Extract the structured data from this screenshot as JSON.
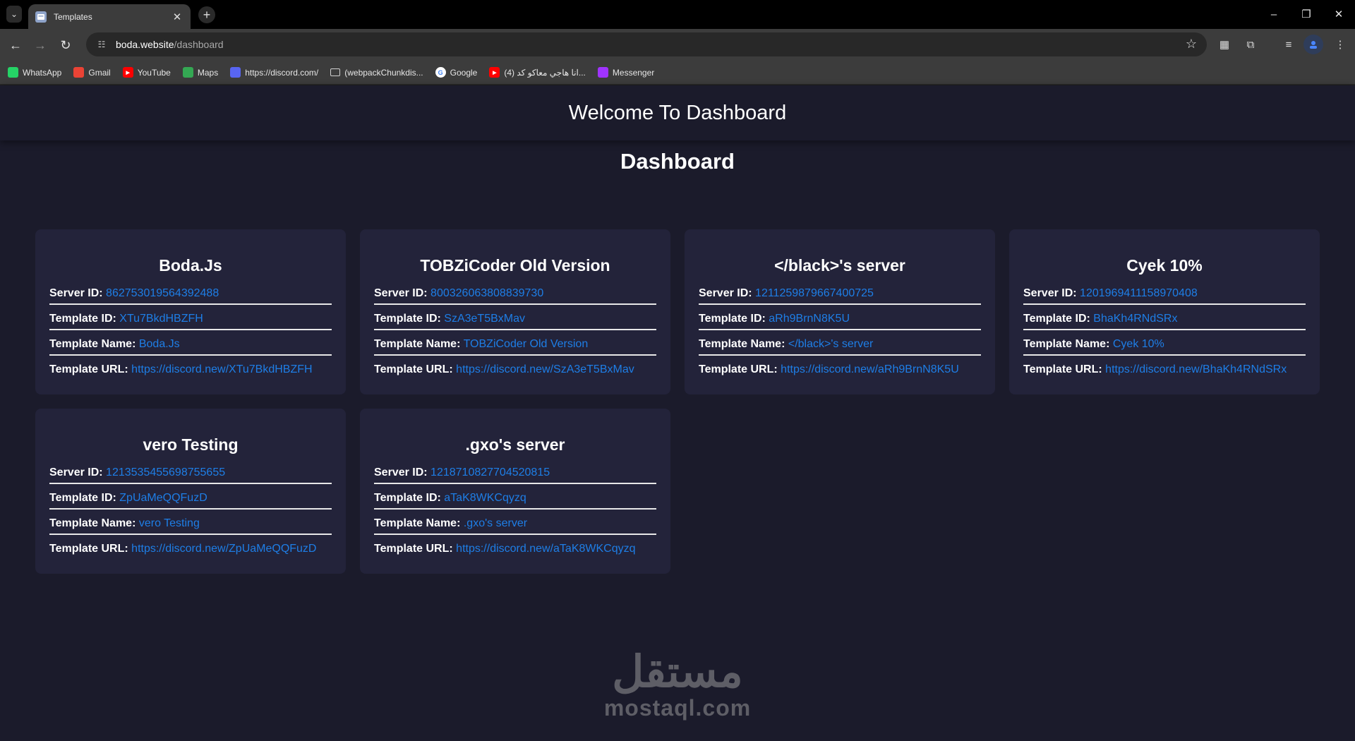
{
  "browser": {
    "tab_title": "Templates",
    "url_host": "boda.website",
    "url_path": "/dashboard",
    "bookmarks": [
      {
        "label": "WhatsApp",
        "icon": "whatsapp-icon",
        "color": "#25d366"
      },
      {
        "label": "Gmail",
        "icon": "gmail-icon",
        "color": "#ea4335"
      },
      {
        "label": "YouTube",
        "icon": "youtube-icon",
        "color": "#ff0000"
      },
      {
        "label": "Maps",
        "icon": "maps-icon",
        "color": "#34a853"
      },
      {
        "label": "https://discord.com/",
        "icon": "discord-icon",
        "color": "#5865f2"
      },
      {
        "label": "(webpackChunkdis...",
        "icon": "folder-icon",
        "color": "#3c3c3c"
      },
      {
        "label": "Google",
        "icon": "google-icon",
        "color": "#ffffff"
      },
      {
        "label": "(4) انا هاجي معاكو كد...",
        "icon": "youtube-icon",
        "color": "#ff0000"
      },
      {
        "label": "Messenger",
        "icon": "messenger-icon",
        "color": "#a033ff"
      }
    ]
  },
  "page": {
    "header_title": "Welcome To Dashboard",
    "dashboard_title": "Dashboard",
    "labels": {
      "server_id": "Server ID:",
      "template_id": "Template ID:",
      "template_name": "Template Name:",
      "template_url": "Template URL:"
    },
    "cards": [
      {
        "name": "Boda.Js",
        "server_id": "862753019564392488",
        "template_id": "XTu7BkdHBZFH",
        "template_name": "Boda.Js",
        "template_url": "https://discord.new/XTu7BkdHBZFH"
      },
      {
        "name": "TOBZiCoder Old Version",
        "server_id": "800326063808839730",
        "template_id": "SzA3eT5BxMav",
        "template_name": "TOBZiCoder Old Version",
        "template_url": "https://discord.new/SzA3eT5BxMav"
      },
      {
        "name": "</black>'s server",
        "server_id": "1211259879667400725",
        "template_id": "aRh9BrnN8K5U",
        "template_name": "</black>'s server",
        "template_url": "https://discord.new/aRh9BrnN8K5U"
      },
      {
        "name": "Cyek 10%",
        "server_id": "1201969411158970408",
        "template_id": "BhaKh4RNdSRx",
        "template_name": "Cyek 10%",
        "template_url": "https://discord.new/BhaKh4RNdSRx"
      },
      {
        "name": "vero Testing",
        "server_id": "1213535455698755655",
        "template_id": "ZpUaMeQQFuzD",
        "template_name": "vero Testing",
        "template_url": "https://discord.new/ZpUaMeQQFuzD"
      },
      {
        "name": ".gxo's server",
        "server_id": "1218710827704520815",
        "template_id": "aTaK8WKCqyzq",
        "template_name": ".gxo's server",
        "template_url": "https://discord.new/aTaK8WKCqyzq"
      }
    ],
    "watermark": {
      "arabic": "مستقل",
      "latin": "mostaql.com"
    }
  }
}
